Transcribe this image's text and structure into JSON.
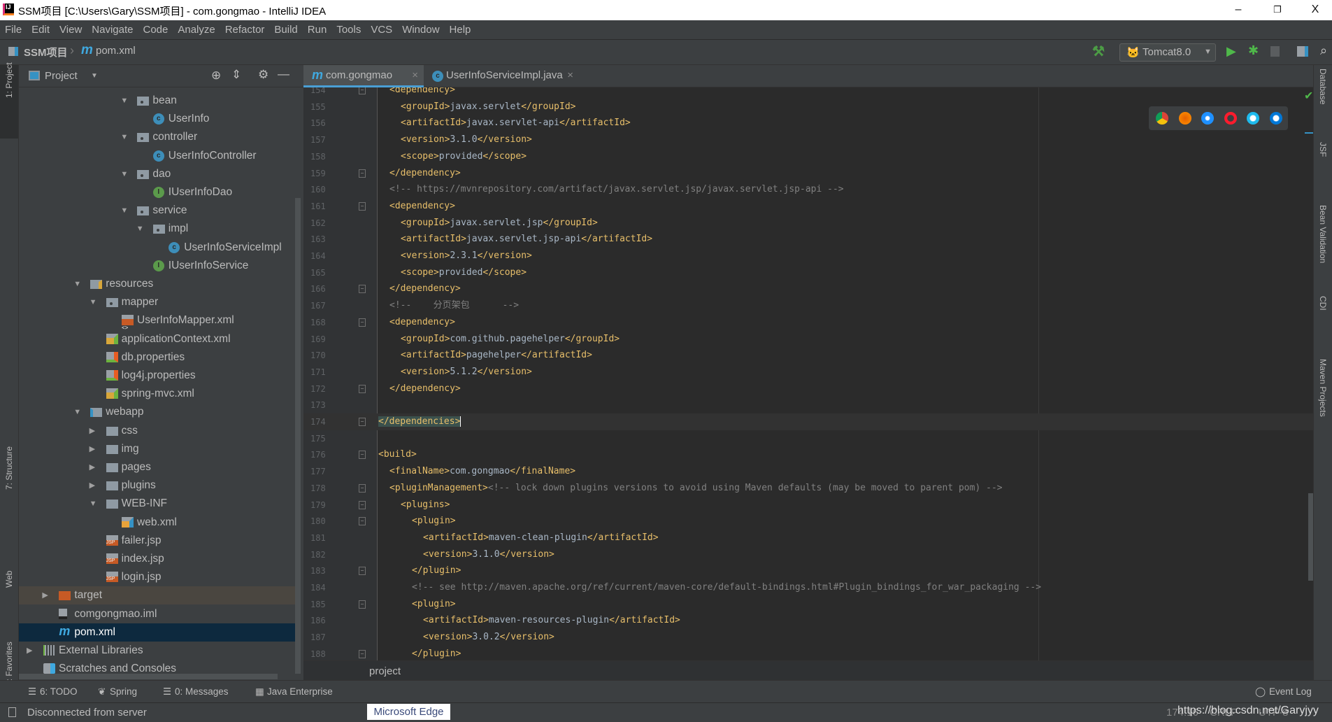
{
  "window": {
    "title": "SSM项目 [C:\\Users\\Gary\\SSM项目] - com.gongmao - IntelliJ IDEA",
    "minimize": "–",
    "restore": "❐",
    "close": "X"
  },
  "menu": [
    "File",
    "Edit",
    "View",
    "Navigate",
    "Code",
    "Analyze",
    "Refactor",
    "Build",
    "Run",
    "Tools",
    "VCS",
    "Window",
    "Help"
  ],
  "navbar": {
    "project": "SSM项目",
    "file": "pom.xml",
    "run_config": "Tomcat8.0"
  },
  "left_strip": [
    "1: Project",
    "7: Structure",
    "Web",
    "2: Favorites"
  ],
  "right_strip": [
    "Database",
    "JSF",
    "Bean Validation",
    "CDI",
    "Maven Projects"
  ],
  "project_panel": {
    "title": "Project",
    "tree": [
      {
        "label": "bean",
        "level": 6,
        "icon": "package",
        "expanded": true
      },
      {
        "label": "UserInfo",
        "level": 7,
        "icon": "class"
      },
      {
        "label": "controller",
        "level": 6,
        "icon": "package",
        "expanded": true
      },
      {
        "label": "UserInfoController",
        "level": 7,
        "icon": "class"
      },
      {
        "label": "dao",
        "level": 6,
        "icon": "package",
        "expanded": true
      },
      {
        "label": "IUserInfoDao",
        "level": 7,
        "icon": "interface"
      },
      {
        "label": "service",
        "level": 6,
        "icon": "package",
        "expanded": true
      },
      {
        "label": "impl",
        "level": 7,
        "icon": "package",
        "expanded": true
      },
      {
        "label": "UserInfoServiceImpl",
        "level": 8,
        "icon": "class"
      },
      {
        "label": "IUserInfoService",
        "level": 7,
        "icon": "interface"
      },
      {
        "label": "resources",
        "level": 3,
        "icon": "resources-folder",
        "expanded": true
      },
      {
        "label": "mapper",
        "level": 4,
        "icon": "package",
        "expanded": true
      },
      {
        "label": "UserInfoMapper.xml",
        "level": 5,
        "icon": "xml"
      },
      {
        "label": "applicationContext.xml",
        "level": 4,
        "icon": "spring-xml"
      },
      {
        "label": "db.properties",
        "level": 4,
        "icon": "properties"
      },
      {
        "label": "log4j.properties",
        "level": 4,
        "icon": "properties"
      },
      {
        "label": "spring-mvc.xml",
        "level": 4,
        "icon": "spring-xml"
      },
      {
        "label": "webapp",
        "level": 3,
        "icon": "web-folder",
        "expanded": true
      },
      {
        "label": "css",
        "level": 4,
        "icon": "folder",
        "expanded": false
      },
      {
        "label": "img",
        "level": 4,
        "icon": "folder",
        "expanded": false
      },
      {
        "label": "pages",
        "level": 4,
        "icon": "folder",
        "expanded": false
      },
      {
        "label": "plugins",
        "level": 4,
        "icon": "folder",
        "expanded": false
      },
      {
        "label": "WEB-INF",
        "level": 4,
        "icon": "folder",
        "expanded": true
      },
      {
        "label": "web.xml",
        "level": 5,
        "icon": "web-xml"
      },
      {
        "label": "failer.jsp",
        "level": 4,
        "icon": "jsp"
      },
      {
        "label": "index.jsp",
        "level": 4,
        "icon": "jsp"
      },
      {
        "label": "login.jsp",
        "level": 4,
        "icon": "jsp"
      },
      {
        "label": "target",
        "level": 1,
        "icon": "excluded-folder",
        "expanded": false,
        "state": "excluded"
      },
      {
        "label": "comgongmao.iml",
        "level": 1,
        "icon": "iml"
      },
      {
        "label": "pom.xml",
        "level": 1,
        "icon": "maven",
        "state": "selected"
      },
      {
        "label": "External Libraries",
        "level": 0,
        "icon": "libraries",
        "expanded": false
      },
      {
        "label": "Scratches and Consoles",
        "level": 0,
        "icon": "scratches"
      }
    ]
  },
  "tabs": [
    {
      "label": "com.gongmao",
      "icon": "maven",
      "active": true
    },
    {
      "label": "UserInfoServiceImpl.java",
      "icon": "class",
      "active": false
    }
  ],
  "editor": {
    "current_line": 174,
    "lines": [
      {
        "n": 154,
        "indent": 1,
        "fold": "open",
        "tokens": [
          [
            "tag",
            "<dependency>"
          ]
        ]
      },
      {
        "n": 155,
        "indent": 2,
        "tokens": [
          [
            "tag",
            "<groupId>"
          ],
          [
            "text",
            "javax.servlet"
          ],
          [
            "tag",
            "</groupId>"
          ]
        ]
      },
      {
        "n": 156,
        "indent": 2,
        "tokens": [
          [
            "tag",
            "<artifactId>"
          ],
          [
            "text",
            "javax.servlet-api"
          ],
          [
            "tag",
            "</artifactId>"
          ]
        ]
      },
      {
        "n": 157,
        "indent": 2,
        "tokens": [
          [
            "tag",
            "<version>"
          ],
          [
            "text",
            "3.1.0"
          ],
          [
            "tag",
            "</version>"
          ]
        ]
      },
      {
        "n": 158,
        "indent": 2,
        "tokens": [
          [
            "tag",
            "<scope>"
          ],
          [
            "text",
            "provided"
          ],
          [
            "tag",
            "</scope>"
          ]
        ]
      },
      {
        "n": 159,
        "indent": 1,
        "fold": "close",
        "tokens": [
          [
            "tag",
            "</dependency>"
          ]
        ]
      },
      {
        "n": 160,
        "indent": 1,
        "tokens": [
          [
            "comment",
            "<!-- https://mvnrepository.com/artifact/javax.servlet.jsp/javax.servlet.jsp-api -->"
          ]
        ]
      },
      {
        "n": 161,
        "indent": 1,
        "fold": "open",
        "tokens": [
          [
            "tag",
            "<dependency>"
          ]
        ]
      },
      {
        "n": 162,
        "indent": 2,
        "tokens": [
          [
            "tag",
            "<groupId>"
          ],
          [
            "text",
            "javax.servlet.jsp"
          ],
          [
            "tag",
            "</groupId>"
          ]
        ]
      },
      {
        "n": 163,
        "indent": 2,
        "tokens": [
          [
            "tag",
            "<artifactId>"
          ],
          [
            "text",
            "javax.servlet.jsp-api"
          ],
          [
            "tag",
            "</artifactId>"
          ]
        ]
      },
      {
        "n": 164,
        "indent": 2,
        "tokens": [
          [
            "tag",
            "<version>"
          ],
          [
            "text",
            "2.3.1"
          ],
          [
            "tag",
            "</version>"
          ]
        ]
      },
      {
        "n": 165,
        "indent": 2,
        "tokens": [
          [
            "tag",
            "<scope>"
          ],
          [
            "text",
            "provided"
          ],
          [
            "tag",
            "</scope>"
          ]
        ]
      },
      {
        "n": 166,
        "indent": 1,
        "fold": "close",
        "tokens": [
          [
            "tag",
            "</dependency>"
          ]
        ]
      },
      {
        "n": 167,
        "indent": 1,
        "tokens": [
          [
            "comment",
            "<!--    分页架包      -->"
          ]
        ]
      },
      {
        "n": 168,
        "indent": 1,
        "fold": "open",
        "tokens": [
          [
            "tag",
            "<dependency>"
          ]
        ]
      },
      {
        "n": 169,
        "indent": 2,
        "tokens": [
          [
            "tag",
            "<groupId>"
          ],
          [
            "text",
            "com.github.pagehelper"
          ],
          [
            "tag",
            "</groupId>"
          ]
        ]
      },
      {
        "n": 170,
        "indent": 2,
        "tokens": [
          [
            "tag",
            "<artifactId>"
          ],
          [
            "text",
            "pagehelper"
          ],
          [
            "tag",
            "</artifactId>"
          ]
        ]
      },
      {
        "n": 171,
        "indent": 2,
        "tokens": [
          [
            "tag",
            "<version>"
          ],
          [
            "text",
            "5.1.2"
          ],
          [
            "tag",
            "</version>"
          ]
        ]
      },
      {
        "n": 172,
        "indent": 1,
        "fold": "close",
        "tokens": [
          [
            "tag",
            "</dependency>"
          ]
        ]
      },
      {
        "n": 173,
        "indent": 0,
        "tokens": []
      },
      {
        "n": 174,
        "indent": 0,
        "fold": "close",
        "tokens": [
          [
            "tag",
            "</dependencies>"
          ]
        ]
      },
      {
        "n": 175,
        "indent": 0,
        "tokens": []
      },
      {
        "n": 176,
        "indent": 0,
        "fold": "open",
        "tokens": [
          [
            "tag",
            "<build>"
          ]
        ]
      },
      {
        "n": 177,
        "indent": 1,
        "tokens": [
          [
            "tag",
            "<finalName>"
          ],
          [
            "text",
            "com.gongmao"
          ],
          [
            "tag",
            "</finalName>"
          ]
        ]
      },
      {
        "n": 178,
        "indent": 1,
        "fold": "open",
        "tokens": [
          [
            "tag",
            "<pluginManagement>"
          ],
          [
            "comment",
            "<!-- lock down plugins versions to avoid using Maven defaults (may be moved to parent pom) -->"
          ]
        ]
      },
      {
        "n": 179,
        "indent": 2,
        "fold": "open",
        "tokens": [
          [
            "tag",
            "<plugins>"
          ]
        ]
      },
      {
        "n": 180,
        "indent": 3,
        "fold": "open",
        "tokens": [
          [
            "tag",
            "<plugin>"
          ]
        ]
      },
      {
        "n": 181,
        "indent": 4,
        "tokens": [
          [
            "tag",
            "<artifactId>"
          ],
          [
            "text",
            "maven-clean-plugin"
          ],
          [
            "tag",
            "</artifactId>"
          ]
        ]
      },
      {
        "n": 182,
        "indent": 4,
        "tokens": [
          [
            "tag",
            "<version>"
          ],
          [
            "text",
            "3.1.0"
          ],
          [
            "tag",
            "</version>"
          ]
        ]
      },
      {
        "n": 183,
        "indent": 3,
        "fold": "close",
        "tokens": [
          [
            "tag",
            "</plugin>"
          ]
        ]
      },
      {
        "n": 184,
        "indent": 3,
        "tokens": [
          [
            "comment",
            "<!-- see http://maven.apache.org/ref/current/maven-core/default-bindings.html#Plugin_bindings_for_war_packaging -->"
          ]
        ]
      },
      {
        "n": 185,
        "indent": 3,
        "fold": "open",
        "tokens": [
          [
            "tag",
            "<plugin>"
          ]
        ]
      },
      {
        "n": 186,
        "indent": 4,
        "tokens": [
          [
            "tag",
            "<artifactId>"
          ],
          [
            "text",
            "maven-resources-plugin"
          ],
          [
            "tag",
            "</artifactId>"
          ]
        ]
      },
      {
        "n": 187,
        "indent": 4,
        "tokens": [
          [
            "tag",
            "<version>"
          ],
          [
            "text",
            "3.0.2"
          ],
          [
            "tag",
            "</version>"
          ]
        ]
      },
      {
        "n": 188,
        "indent": 3,
        "fold": "close",
        "tokens": [
          [
            "tag",
            "</plugin>"
          ]
        ]
      }
    ],
    "breadcrumb": "project",
    "browsers": [
      "chrome",
      "firefox",
      "safari",
      "opera",
      "internet-explorer",
      "edge"
    ]
  },
  "bottom_tools": [
    "6: TODO",
    "Spring",
    "0: Messages",
    "Java Enterprise"
  ],
  "event_log": "Event Log",
  "status": {
    "message": "Disconnected from server",
    "position": "174:16",
    "line_sep": "CRLF",
    "encoding": "UTF-8",
    "watermark": "https://blog.csdn.net/Garyjyy"
  },
  "tooltip": "Microsoft Edge",
  "colors": {
    "tag": "#e8bf6a",
    "text": "#a9b7c6",
    "comment": "#808080",
    "editor_bg": "#2b2b2b",
    "selection": "#0d293e",
    "accent": "#4a9fd5"
  }
}
